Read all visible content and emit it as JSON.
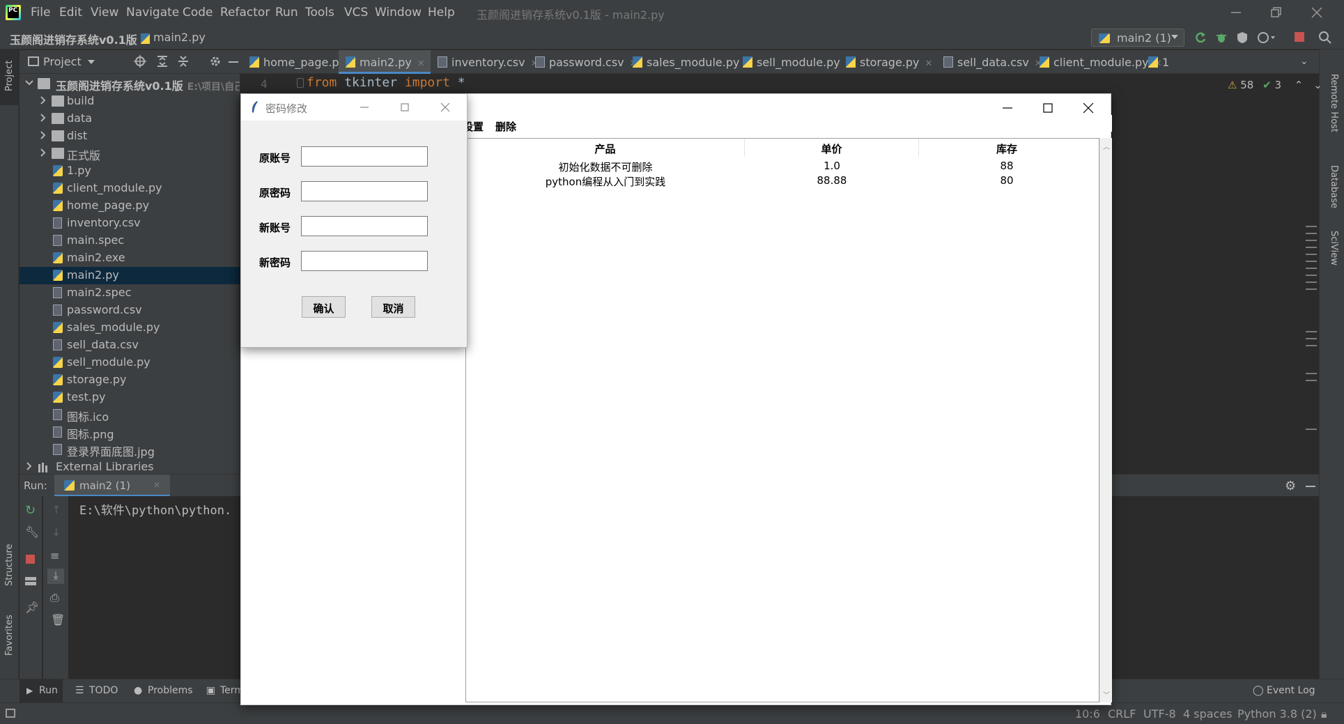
{
  "ide": {
    "menu": [
      "File",
      "Edit",
      "View",
      "Navigate",
      "Code",
      "Refactor",
      "Run",
      "Tools",
      "VCS",
      "Window",
      "Help"
    ],
    "window_title": "玉颜阁进销存系统v0.1版 - main2.py",
    "breadcrumb": {
      "project": "玉颜阁进销存系统v0.1版",
      "file": "main2.py"
    },
    "run_config": "main2 (1)",
    "left_stripe": [
      "Project",
      "Structure",
      "Favorites"
    ],
    "right_stripe": [
      "Remote Host",
      "Database",
      "SciView"
    ],
    "project_panel": {
      "title": "Project",
      "root": {
        "name": "玉颜阁进销存系统v0.1版",
        "path": "E:\\项目\\自己开"
      },
      "items": [
        {
          "name": "build",
          "type": "folder"
        },
        {
          "name": "data",
          "type": "folder"
        },
        {
          "name": "dist",
          "type": "folder"
        },
        {
          "name": "正式版",
          "type": "folder"
        },
        {
          "name": "1.py",
          "type": "py"
        },
        {
          "name": "client_module.py",
          "type": "py"
        },
        {
          "name": "home_page.py",
          "type": "py"
        },
        {
          "name": "inventory.csv",
          "type": "file"
        },
        {
          "name": "main.spec",
          "type": "file"
        },
        {
          "name": "main2.exe",
          "type": "py"
        },
        {
          "name": "main2.py",
          "type": "py"
        },
        {
          "name": "main2.spec",
          "type": "file"
        },
        {
          "name": "password.csv",
          "type": "file"
        },
        {
          "name": "sales_module.py",
          "type": "py"
        },
        {
          "name": "sell_data.csv",
          "type": "file"
        },
        {
          "name": "sell_module.py",
          "type": "py"
        },
        {
          "name": "storage.py",
          "type": "py"
        },
        {
          "name": "test.py",
          "type": "py"
        },
        {
          "name": "图标.ico",
          "type": "file"
        },
        {
          "name": "图标.png",
          "type": "file"
        },
        {
          "name": "登录界面底图.jpg",
          "type": "file"
        }
      ],
      "external": "External Libraries"
    },
    "editor_tabs": [
      "home_page.py",
      "main2.py",
      "inventory.csv",
      "password.csv",
      "sales_module.py",
      "sell_module.py",
      "storage.py",
      "sell_data.csv",
      "client_module.py",
      "1"
    ],
    "editor": {
      "line_number": "4",
      "code_from": "from",
      "code_module": " tkinter ",
      "code_import": "import",
      "code_rest": " *"
    },
    "inspections": {
      "warnings": "58",
      "ok": "3"
    },
    "run_panel": {
      "label": "Run:",
      "tab": "main2 (1)",
      "console": "E:\\软件\\python\\python."
    },
    "bottom_tabs": [
      "Run",
      "TODO",
      "Problems",
      "Term"
    ],
    "event_log": "Event Log",
    "status": {
      "position": "10:6",
      "line_sep": "CRLF",
      "encoding": "UTF-8",
      "indent": "4 spaces",
      "interpreter": "Python 3.8 (2)"
    }
  },
  "tk_main": {
    "menu": [
      "设置",
      "删除"
    ],
    "menu_prefix_visible": "设置",
    "columns": [
      "产品",
      "单价",
      "库存"
    ],
    "rows": [
      [
        "初始化数据不可删除",
        "1.0",
        "88"
      ],
      [
        "python编程从入门到实践",
        "88.88",
        "80"
      ]
    ]
  },
  "dialog": {
    "title": "密码修改",
    "fields": [
      {
        "label": "原账号",
        "value": ""
      },
      {
        "label": "原密码",
        "value": ""
      },
      {
        "label": "新账号",
        "value": ""
      },
      {
        "label": "新密码",
        "value": ""
      }
    ],
    "confirm": "确认",
    "cancel": "取消"
  }
}
